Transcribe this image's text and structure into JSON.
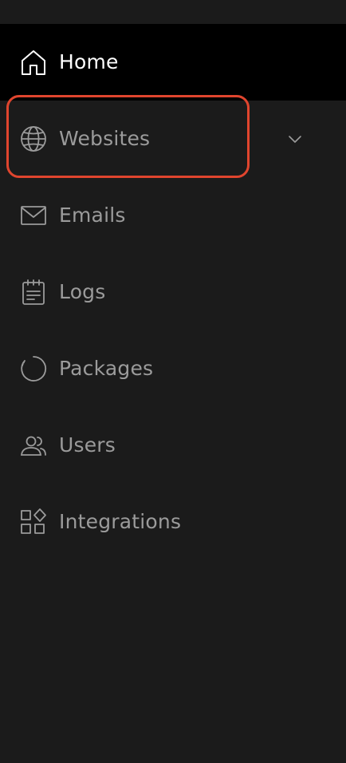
{
  "nav": {
    "items": [
      {
        "label": "Home",
        "icon": "home-icon",
        "active": true
      },
      {
        "label": "Websites",
        "icon": "globe-icon",
        "active": false,
        "expandable": true
      },
      {
        "label": "Emails",
        "icon": "mail-icon",
        "active": false
      },
      {
        "label": "Logs",
        "icon": "calendar-icon",
        "active": false
      },
      {
        "label": "Packages",
        "icon": "loader-icon",
        "active": false
      },
      {
        "label": "Users",
        "icon": "users-icon",
        "active": false
      },
      {
        "label": "Integrations",
        "icon": "grid-icon",
        "active": false
      }
    ]
  },
  "colors": {
    "background": "#1b1b1b",
    "active_background": "#000000",
    "active_text": "#ffffff",
    "inactive_text": "#9b9b9b",
    "highlight_border": "#e0452e"
  }
}
